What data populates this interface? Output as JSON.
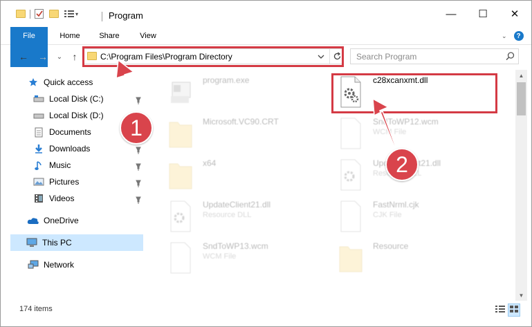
{
  "window": {
    "title": "Program",
    "minimize_symbol": "—",
    "maximize_symbol": "☐",
    "close_symbol": "✕"
  },
  "ribbon": {
    "tabs": [
      {
        "label": "File",
        "active": true
      },
      {
        "label": "Home"
      },
      {
        "label": "Share"
      },
      {
        "label": "View"
      }
    ]
  },
  "nav": {
    "back_symbol": "←",
    "forward_symbol": "→",
    "recent_symbol": "⌄",
    "up_symbol": "↑",
    "address": "C:\\Program Files\\Program Directory",
    "search_placeholder": "Search Program"
  },
  "sidebar": {
    "items": [
      {
        "label": "Quick access",
        "icon": "star-icon",
        "pinned": false
      },
      {
        "label": "Local Disk (C:)",
        "icon": "drive-icon",
        "pinned": true
      },
      {
        "label": "Local Disk (D:)",
        "icon": "drive-icon",
        "pinned": true
      },
      {
        "label": "Documents",
        "icon": "documents-icon",
        "pinned": true
      },
      {
        "label": "Downloads",
        "icon": "download-icon",
        "pinned": true
      },
      {
        "label": "Music",
        "icon": "music-icon",
        "pinned": true
      },
      {
        "label": "Pictures",
        "icon": "pictures-icon",
        "pinned": true
      },
      {
        "label": "Videos",
        "icon": "videos-icon",
        "pinned": true
      },
      {
        "label": "OneDrive",
        "icon": "cloud-icon",
        "pinned": false
      },
      {
        "label": "This PC",
        "icon": "computer-icon",
        "selected": true
      },
      {
        "label": "Network",
        "icon": "network-icon",
        "pinned": false
      }
    ]
  },
  "files": [
    {
      "name": "program.exe",
      "sub": "",
      "type": "exe",
      "faded": true
    },
    {
      "name": "c28xcanxmt.dll",
      "sub": "",
      "type": "dll",
      "faded": false,
      "highlighted": true
    },
    {
      "name": "Microsoft.VC90.CRT",
      "sub": "",
      "type": "folder",
      "faded": true
    },
    {
      "name": "SndToWP12.wcm",
      "sub": "WCM File",
      "type": "file",
      "faded": true
    },
    {
      "name": "x64",
      "sub": "",
      "type": "folder",
      "faded": true
    },
    {
      "name": "UpdateClient21.dll",
      "sub": "Resource DLL",
      "type": "dll",
      "faded": true
    },
    {
      "name": "UpdateClient21.dll",
      "sub": "Resource DLL",
      "type": "dll",
      "faded": true
    },
    {
      "name": "FastNrml.cjk",
      "sub": "CJK File",
      "type": "file",
      "faded": true
    },
    {
      "name": "SndToWP13.wcm",
      "sub": "WCM File",
      "type": "file",
      "faded": true
    },
    {
      "name": "Resource",
      "sub": "",
      "type": "folder",
      "faded": true
    }
  ],
  "status": {
    "item_count": "174 items"
  },
  "annotations": {
    "step1": "1",
    "step2": "2",
    "color": "#d43a44"
  },
  "colors": {
    "accent": "#1979ca",
    "selection": "#cde8ff",
    "folder": "#f8d775"
  }
}
